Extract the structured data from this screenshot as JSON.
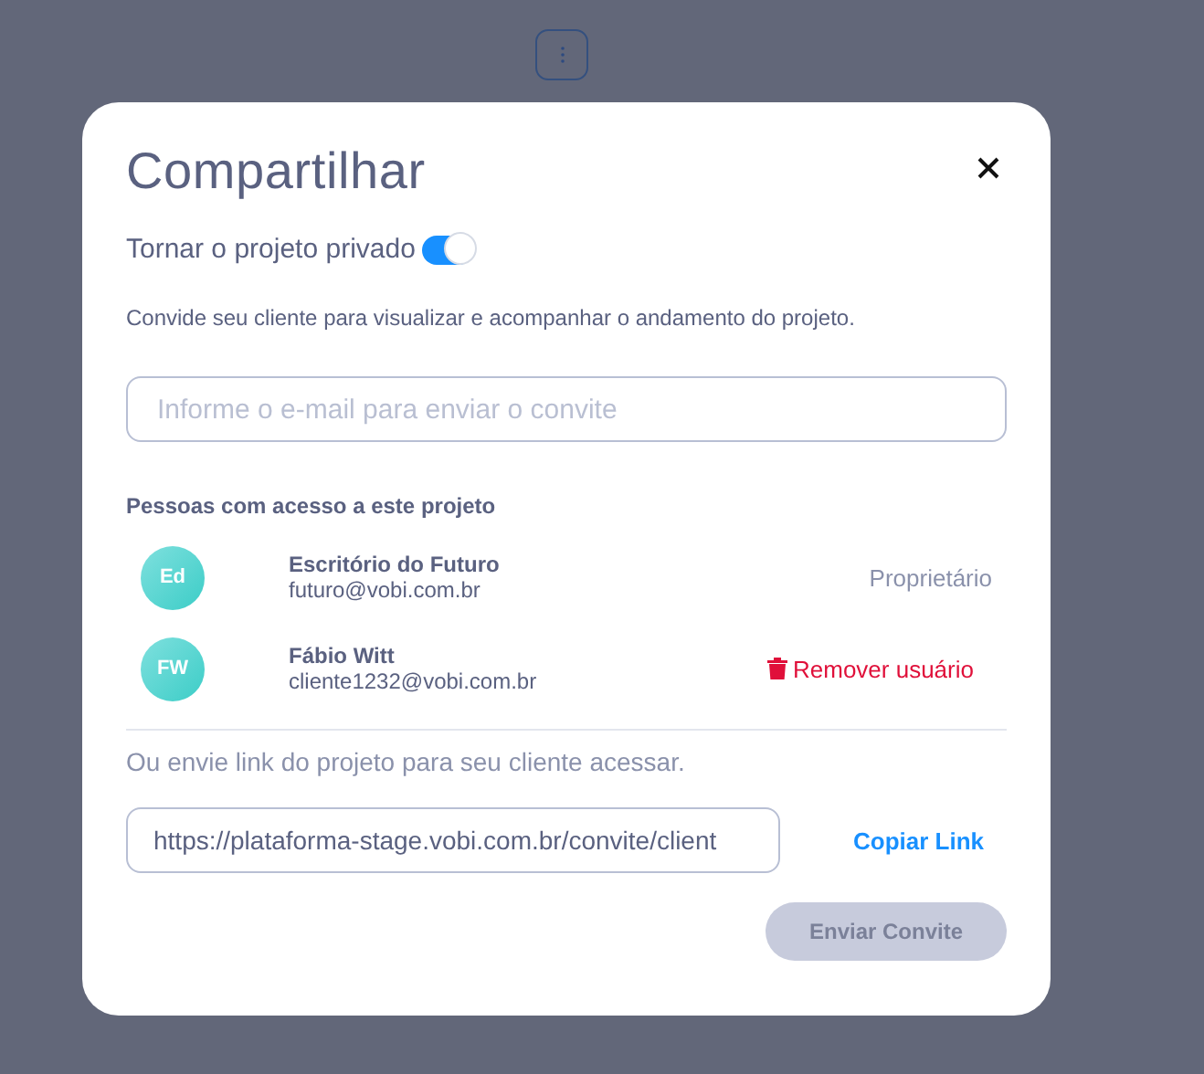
{
  "dialog": {
    "title": "Compartilhar",
    "private_toggle": {
      "label": "Tornar o projeto privado",
      "on": true
    },
    "description": "Convide seu cliente para visualizar e acompanhar o andamento do projeto.",
    "email_field": {
      "placeholder": "Informe o e-mail para enviar o convite"
    },
    "people_heading": "Pessoas com acesso a este projeto",
    "people": [
      {
        "initials": "Ed",
        "name": "Escritório do Futuro",
        "email": "futuro@vobi.com.br",
        "kind": "role",
        "action": "Proprietário"
      },
      {
        "initials": "FW",
        "name": "Fábio Witt",
        "email": "cliente1232@vobi.com.br",
        "kind": "remove",
        "action": "Remover usuário"
      }
    ],
    "link_hint": "Ou envie link do projeto para seu cliente acessar.",
    "link_field": {
      "value": "https://plataforma-stage.vobi.com.br/convite/client"
    },
    "copy_link": "Copiar Link",
    "send_button": {
      "label": "Enviar Convite",
      "disabled": true
    }
  }
}
